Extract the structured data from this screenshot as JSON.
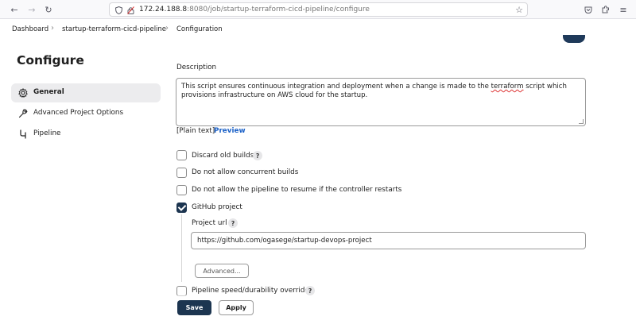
{
  "browser": {
    "url_host": "172.24.188.8",
    "url_rest": ":8080/job/startup-terraform-cicd-pipeline/configure",
    "icons": [
      "back-icon",
      "forward-icon",
      "reload-icon",
      "shield-icon",
      "lock-icon",
      "bookmark-star-icon",
      "pocket-icon",
      "extensions-icon",
      "menu-icon"
    ]
  },
  "breadcrumb": {
    "items": [
      "Dashboard",
      "startup-terraform-cicd-pipeline",
      "Configuration"
    ]
  },
  "sidebar": {
    "title": "Configure",
    "items": [
      {
        "label": "General",
        "icon": "gear-icon",
        "active": true
      },
      {
        "label": "Advanced Project Options",
        "icon": "wrench-icon",
        "active": false
      },
      {
        "label": "Pipeline",
        "icon": "pipeline-icon",
        "active": false
      }
    ]
  },
  "form": {
    "description_label": "Description",
    "description_before": "This script ensures continuous integration and deployment when a change is made to the ",
    "description_marked": "terraform",
    "description_after": " script which provisions infrastructure on AWS cloud for the startup.",
    "plain_text": "[Plain text]",
    "preview": "Preview",
    "options": [
      {
        "label": "Discard old builds",
        "checked": false,
        "help": "?"
      },
      {
        "label": "Do not allow concurrent builds",
        "checked": false
      },
      {
        "label": "Do not allow the pipeline to resume if the controller restarts",
        "checked": false
      },
      {
        "label": "GitHub project",
        "checked": true
      },
      {
        "label": "Pipeline speed/durability override",
        "checked": false,
        "help": "?"
      }
    ],
    "project_url_label": "Project url",
    "project_url_help": "?",
    "project_url_value": "https://github.com/ogasege/startup-devops-project",
    "advanced_button": "Advanced..."
  },
  "actions": {
    "save": "Save",
    "apply": "Apply"
  },
  "colors": {
    "primary": "#1c3550",
    "link": "#1a60c7",
    "active_bg": "#ececee"
  }
}
